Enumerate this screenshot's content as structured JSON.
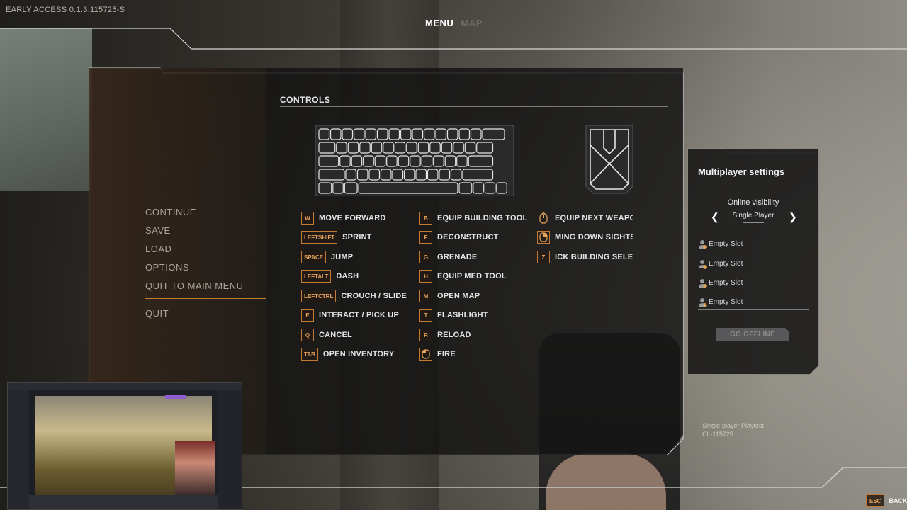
{
  "build_label": "EARLY ACCESS 0.1.3.115725-S",
  "top_nav": {
    "menu": "MENU",
    "map": "MAP"
  },
  "side_menu": [
    {
      "label": "CONTINUE"
    },
    {
      "label": "SAVE"
    },
    {
      "label": "LOAD"
    },
    {
      "label": "OPTIONS"
    },
    {
      "label": "QUIT TO MAIN MENU"
    },
    {
      "label": "QUIT"
    }
  ],
  "controls": {
    "title": "CONTROLS",
    "column1": [
      {
        "key": "W",
        "action": "MOVE FORWARD"
      },
      {
        "key": "LEFTSHIFT",
        "action": "SPRINT"
      },
      {
        "key": "SPACE",
        "action": "JUMP"
      },
      {
        "key": "LEFTALT",
        "action": "DASH"
      },
      {
        "key": "LEFTCTRL",
        "action": "CROUCH / SLIDE"
      },
      {
        "key": "E",
        "action": "INTERACT / PICK UP"
      },
      {
        "key": "Q",
        "action": "CANCEL"
      },
      {
        "key": "TAB",
        "action": "OPEN INVENTORY"
      }
    ],
    "column2": [
      {
        "key": "B",
        "action": "EQUIP BUILDING TOOL"
      },
      {
        "key": "F",
        "action": "DECONSTRUCT"
      },
      {
        "key": "G",
        "action": "GRENADE"
      },
      {
        "key": "H",
        "action": "EQUIP MED TOOL"
      },
      {
        "key": "M",
        "action": "OPEN MAP"
      },
      {
        "key": "T",
        "action": "FLASHLIGHT"
      },
      {
        "key": "R",
        "action": "RELOAD"
      },
      {
        "key": "",
        "icon": "mouse-left-button-icon",
        "action": "FIRE"
      }
    ],
    "column3": [
      {
        "key": "",
        "icon": "mouse-scroll-icon",
        "action": "EQUIP NEXT WEAPON"
      },
      {
        "key": "",
        "icon": "mouse-right-button-icon",
        "action": "MING DOWN SIGHTS (A"
      },
      {
        "key": "Z",
        "action": "ICK BUILDING SELECTI"
      }
    ]
  },
  "multiplayer": {
    "title": "Multiplayer settings",
    "visibility_label": "Online visibility",
    "visibility_value": "Single Player",
    "slots": [
      "Empty Slot",
      "Empty Slot",
      "Empty Slot",
      "Empty Slot"
    ],
    "go_offline": "GO OFFLINE"
  },
  "playtest": {
    "line1": "Single-player Playtest",
    "line2": "CL-115725"
  },
  "footer": {
    "esc_key": "ESC",
    "back_label": "BACK"
  },
  "colors": {
    "accent": "#c47a32",
    "accent_text": "#e7a35b"
  }
}
